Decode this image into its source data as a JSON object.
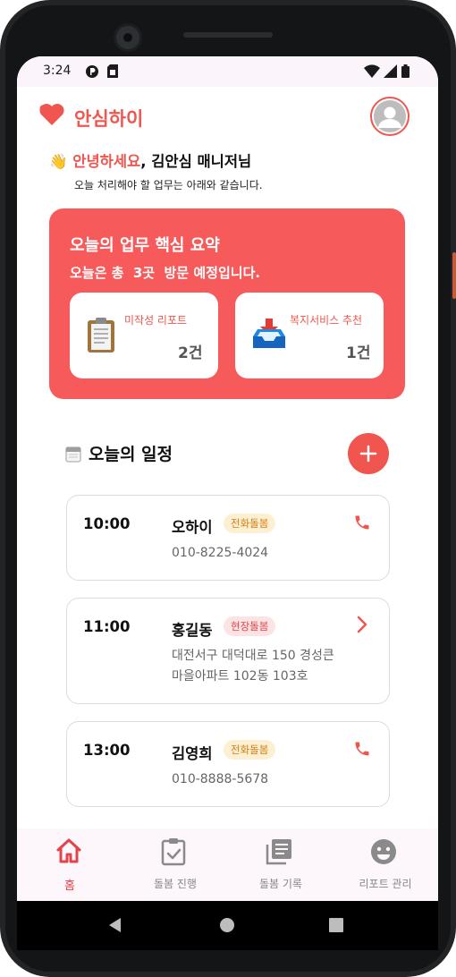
{
  "status_bar": {
    "time": "3:24"
  },
  "header": {
    "brand": "안심하이"
  },
  "greeting": {
    "hello": "안녕하세요",
    "name": ", 김안심 매니저님",
    "subtitle": "오늘 처리해야 할 업무는 아래와 같습니다."
  },
  "summary": {
    "title": "오늘의 업무 핵심 요약",
    "subtitle": "오늘은 총  3곳  방문 예정입니다.",
    "color": "#f65a5a",
    "cards": [
      {
        "label": "미작성 리포트",
        "count": "2건",
        "icon": "clipboard-icon"
      },
      {
        "label": "복지서비스 추천",
        "count": "1건",
        "icon": "inbox-tray-icon"
      }
    ]
  },
  "schedule": {
    "title": "오늘의 일정",
    "items": [
      {
        "time": "10:00",
        "name": "오하이",
        "type": "전화돌봄",
        "detail_line1": "010-8225-4024",
        "detail_line2": "",
        "action": "phone-icon"
      },
      {
        "time": "11:00",
        "name": "홍길동",
        "type": "현장돌봄",
        "detail_line1": "대전서구 대덕대로 150 경성큰",
        "detail_line2": "마을아파트 102동 103호",
        "action": "chevron-right-icon"
      },
      {
        "time": "13:00",
        "name": "김영희",
        "type": "전화돌봄",
        "detail_line1": "010-8888-5678",
        "detail_line2": "",
        "action": "phone-icon"
      }
    ]
  },
  "bottom_nav": {
    "items": [
      {
        "label": "홈",
        "icon": "home-icon",
        "active": true
      },
      {
        "label": "돌봄 진행",
        "icon": "clipboard-check-icon",
        "active": false
      },
      {
        "label": "돌봄 기록",
        "icon": "library-books-icon",
        "active": false
      },
      {
        "label": "리포트 관리",
        "icon": "smiley-icon",
        "active": false
      }
    ]
  },
  "colors": {
    "accent": "#f0564f",
    "badge_phone_bg": "#fdf0d2",
    "badge_site_bg": "#fde4e4"
  }
}
